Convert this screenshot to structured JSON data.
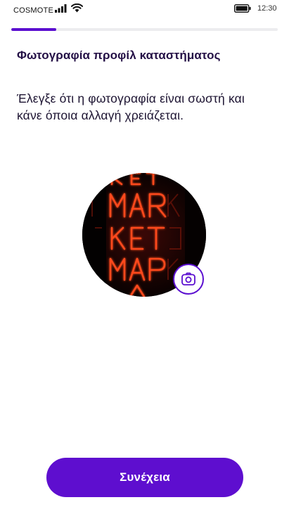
{
  "status_bar": {
    "carrier": "COSMOTE",
    "time": "12:30",
    "icons": [
      "signal-icon",
      "wifi-icon",
      "battery-icon"
    ]
  },
  "progress": {
    "fraction": 0.17
  },
  "header": {
    "title": "Φωτογραφία προφίλ καταστήματος"
  },
  "main": {
    "description": "Έλεγξε ότι η φωτογραφία είναι σωστή και κάνε όποια αλλαγή χρειάζεται.",
    "profile_photo": {
      "icon": "camera-icon"
    }
  },
  "footer": {
    "continue_label": "Συνέχεια"
  },
  "colors": {
    "accent": "#5e0ecf",
    "title": "#241046",
    "progress_track": "#ececef",
    "neon": "#ff3a1a"
  }
}
